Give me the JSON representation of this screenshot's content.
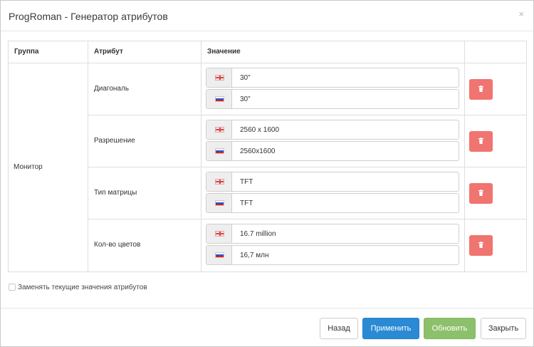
{
  "modal": {
    "title": "ProgRoman - Генератор атрибутов",
    "close_symbol": "×"
  },
  "table": {
    "headers": {
      "group": "Группа",
      "attribute": "Атрибут",
      "value": "Значение",
      "action": ""
    },
    "group": "Монитор",
    "rows": [
      {
        "attribute": "Диагональ",
        "values": [
          {
            "flag": "en-flag-icon",
            "value": "30\""
          },
          {
            "flag": "ru-flag-icon",
            "value": "30\""
          }
        ]
      },
      {
        "attribute": "Разрешение",
        "values": [
          {
            "flag": "en-flag-icon",
            "value": "2560 x 1600"
          },
          {
            "flag": "ru-flag-icon",
            "value": "2560x1600"
          }
        ]
      },
      {
        "attribute": "Тип матрицы",
        "values": [
          {
            "flag": "en-flag-icon",
            "value": "TFT"
          },
          {
            "flag": "ru-flag-icon",
            "value": "TFT"
          }
        ]
      },
      {
        "attribute": "Кол-во цветов",
        "values": [
          {
            "flag": "en-flag-icon",
            "value": "16.7 million"
          },
          {
            "flag": "ru-flag-icon",
            "value": "16,7 млн"
          }
        ]
      }
    ],
    "delete_icon": "trash-icon",
    "delete_color": "#f0746f"
  },
  "options": {
    "replace_checkbox_label": "Заменять текущие значения атрибутов",
    "replace_checked": false
  },
  "footer": {
    "back_label": "Назад",
    "apply_label": "Применить",
    "update_label": "Обновить",
    "close_label": "Закрыть"
  },
  "colors": {
    "apply": "#2a8ad4",
    "update": "#8cc06b",
    "delete": "#f0746f"
  }
}
